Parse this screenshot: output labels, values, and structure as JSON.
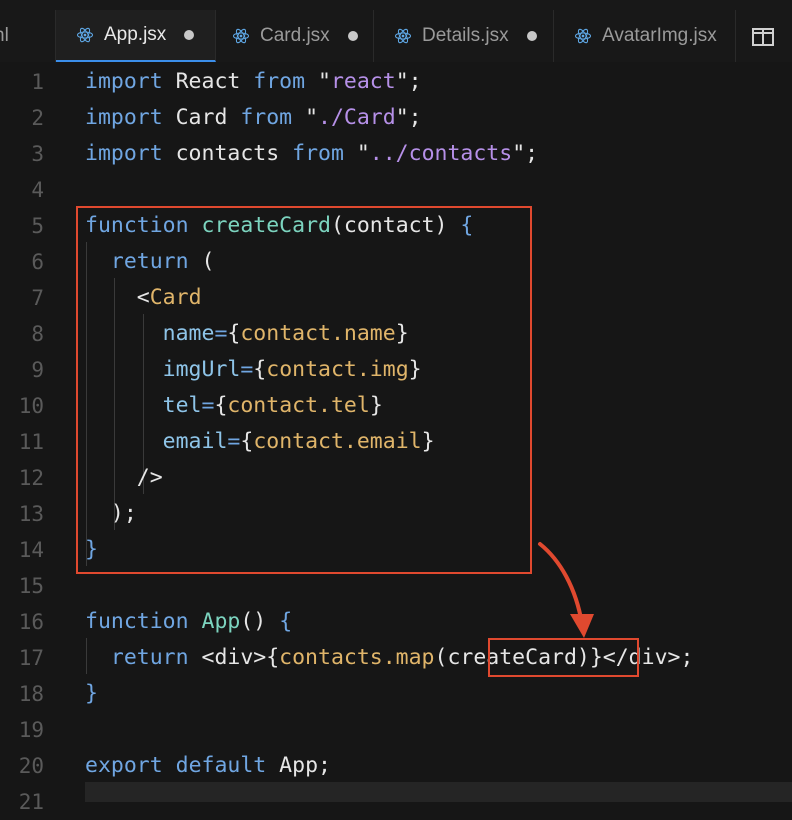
{
  "tabs": [
    {
      "label": "nl",
      "active": false,
      "modified": false,
      "icon": "react-icon"
    },
    {
      "label": "App.jsx",
      "active": true,
      "modified": true,
      "icon": "react-icon"
    },
    {
      "label": "Card.jsx",
      "active": false,
      "modified": true,
      "icon": "react-icon"
    },
    {
      "label": "Details.jsx",
      "active": false,
      "modified": true,
      "icon": "react-icon"
    },
    {
      "label": "AvatarImg.jsx",
      "active": false,
      "modified": false,
      "icon": "react-icon"
    }
  ],
  "split_editor_icon": "split-editor-icon",
  "colors": {
    "keyword": "#70a6e2",
    "function": "#7cd4bf",
    "string": "#b690e8",
    "highlight": "#e0492f"
  },
  "code": [
    {
      "n": "1",
      "tokens": [
        [
          "kw",
          "import"
        ],
        [
          "id",
          " React "
        ],
        [
          "kw",
          "from"
        ],
        [
          "id",
          " \""
        ],
        [
          "str",
          "react"
        ],
        [
          "id",
          "\";"
        ]
      ]
    },
    {
      "n": "2",
      "tokens": [
        [
          "kw",
          "import"
        ],
        [
          "id",
          " Card "
        ],
        [
          "kw",
          "from"
        ],
        [
          "id",
          " \""
        ],
        [
          "str",
          "./Card"
        ],
        [
          "id",
          "\";"
        ]
      ]
    },
    {
      "n": "3",
      "tokens": [
        [
          "kw",
          "import"
        ],
        [
          "id",
          " contacts "
        ],
        [
          "kw",
          "from"
        ],
        [
          "id",
          " \""
        ],
        [
          "str",
          "../contacts"
        ],
        [
          "id",
          "\";"
        ]
      ]
    },
    {
      "n": "4",
      "tokens": []
    },
    {
      "n": "5",
      "tokens": [
        [
          "kw",
          "function"
        ],
        [
          "id",
          " "
        ],
        [
          "fn",
          "createCard"
        ],
        [
          "id",
          "(contact) "
        ],
        [
          "kw",
          "{"
        ]
      ]
    },
    {
      "n": "6",
      "tokens": [
        [
          "id",
          "  "
        ],
        [
          "kw",
          "return"
        ],
        [
          "id",
          " ("
        ]
      ]
    },
    {
      "n": "7",
      "tokens": [
        [
          "id",
          "    <"
        ],
        [
          "tag",
          "Card"
        ]
      ]
    },
    {
      "n": "8",
      "tokens": [
        [
          "id",
          "      "
        ],
        [
          "attr",
          "name"
        ],
        [
          "kw",
          "="
        ],
        [
          "id",
          "{"
        ],
        [
          "var",
          "contact.name"
        ],
        [
          "id",
          "}"
        ]
      ]
    },
    {
      "n": "9",
      "tokens": [
        [
          "id",
          "      "
        ],
        [
          "attr",
          "imgUrl"
        ],
        [
          "kw",
          "="
        ],
        [
          "id",
          "{"
        ],
        [
          "var",
          "contact.img"
        ],
        [
          "id",
          "}"
        ]
      ]
    },
    {
      "n": "10",
      "tokens": [
        [
          "id",
          "      "
        ],
        [
          "attr",
          "tel"
        ],
        [
          "kw",
          "="
        ],
        [
          "id",
          "{"
        ],
        [
          "var",
          "contact.tel"
        ],
        [
          "id",
          "}"
        ]
      ]
    },
    {
      "n": "11",
      "tokens": [
        [
          "id",
          "      "
        ],
        [
          "attr",
          "email"
        ],
        [
          "kw",
          "="
        ],
        [
          "id",
          "{"
        ],
        [
          "var",
          "contact.email"
        ],
        [
          "id",
          "}"
        ]
      ]
    },
    {
      "n": "12",
      "tokens": [
        [
          "id",
          "    />"
        ]
      ]
    },
    {
      "n": "13",
      "tokens": [
        [
          "id",
          "  );"
        ]
      ]
    },
    {
      "n": "14",
      "tokens": [
        [
          "kw",
          "}"
        ]
      ]
    },
    {
      "n": "15",
      "tokens": []
    },
    {
      "n": "16",
      "tokens": [
        [
          "kw",
          "function"
        ],
        [
          "id",
          " "
        ],
        [
          "fn",
          "App"
        ],
        [
          "id",
          "() "
        ],
        [
          "kw",
          "{"
        ]
      ]
    },
    {
      "n": "17",
      "tokens": [
        [
          "id",
          "  "
        ],
        [
          "kw",
          "return"
        ],
        [
          "id",
          " <div>{"
        ],
        [
          "var",
          "contacts.map"
        ],
        [
          "id",
          "(createCard)}</div>;"
        ]
      ]
    },
    {
      "n": "18",
      "tokens": [
        [
          "kw",
          "}"
        ]
      ]
    },
    {
      "n": "19",
      "tokens": []
    },
    {
      "n": "20",
      "tokens": [
        [
          "kw",
          "export"
        ],
        [
          "id",
          " "
        ],
        [
          "kw",
          "default"
        ],
        [
          "id",
          " App;"
        ]
      ]
    },
    {
      "n": "21",
      "tokens": []
    }
  ]
}
